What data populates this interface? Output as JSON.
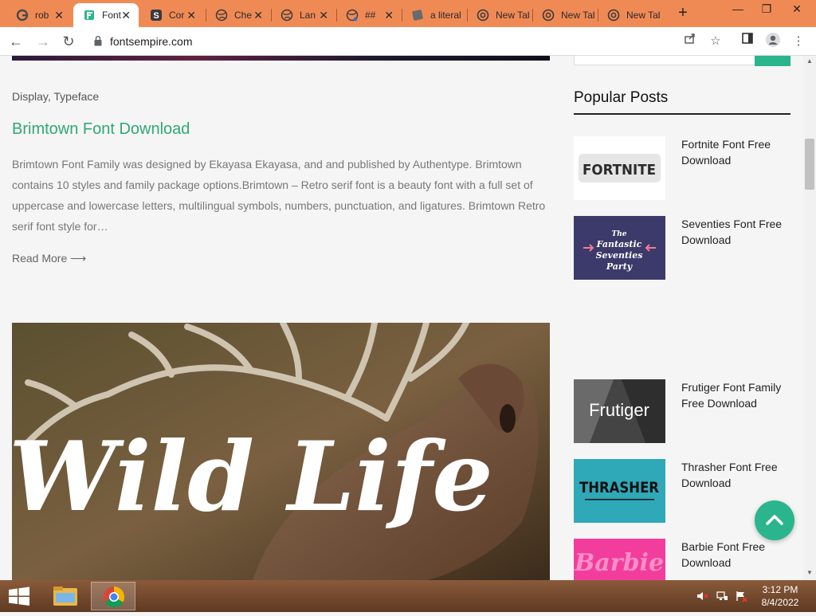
{
  "browser": {
    "tabs": [
      {
        "label": "rob",
        "icon": "google-icon"
      },
      {
        "label": "Font",
        "icon": "fontsempire-icon",
        "active": true
      },
      {
        "label": "Cor",
        "icon": "s-icon"
      },
      {
        "label": "Che",
        "icon": "globe-icon"
      },
      {
        "label": "Lan",
        "icon": "globe-icon"
      },
      {
        "label": "##",
        "icon": "globe-icon"
      },
      {
        "label": "a literal",
        "icon": "page-icon"
      },
      {
        "label": "New Tab",
        "icon": "chrome-icon"
      },
      {
        "label": "New Tab",
        "icon": "chrome-icon"
      },
      {
        "label": "New Tab",
        "icon": "chrome-icon"
      }
    ],
    "url": "fontsempire.com"
  },
  "post": {
    "categories": "Display, Typeface",
    "title": "Brimtown Font Download",
    "excerpt": "Brimtown Font Family was designed by Ekayasa Ekayasa, and and published by Authentype. Brimtown contains 10 styles and family package options.Brimtown – Retro serif font is a beauty font with a full set of uppercase and lowercase letters, multilingual symbols, numbers, punctuation, and ligatures. Brimtown Retro serif font style for…",
    "read_more": "Read More",
    "image_text": "Wild Life"
  },
  "sidebar": {
    "popular_title": "Popular Posts",
    "items": [
      {
        "title": "Fortnite Font Free Download",
        "thumb_text": "FORTNITE"
      },
      {
        "title": "Seventies Font Free Download",
        "thumb_text": "The Fantastic Seventies Party"
      },
      {
        "title": "Frutiger Font Family Free Download",
        "thumb_text": "Frutiger"
      },
      {
        "title": "Thrasher Font Free Download",
        "thumb_text": "THRASHER"
      },
      {
        "title": "Barbie Font Free Download",
        "thumb_text": "Barbie"
      }
    ]
  },
  "taskbar": {
    "time": "3:12 PM",
    "date": "8/4/2022"
  },
  "colors": {
    "accent": "#2bb58c",
    "tab_strip": "#f08a55",
    "title_link": "#2fa877"
  }
}
